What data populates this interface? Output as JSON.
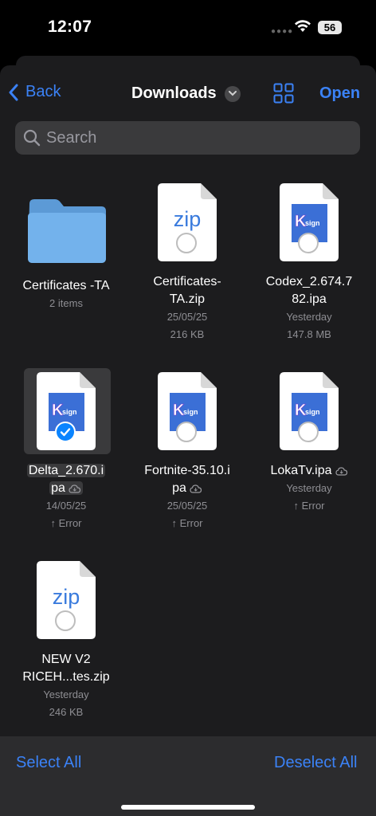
{
  "status": {
    "time": "12:07",
    "battery": "56"
  },
  "nav": {
    "back_label": "Back",
    "title": "Downloads",
    "open_label": "Open"
  },
  "search": {
    "placeholder": "Search"
  },
  "items": [
    {
      "type": "folder",
      "name": "Certificates -TA",
      "meta1": "2 items"
    },
    {
      "type": "zip",
      "name_line1": "Certificates-",
      "name_line2": "TA.zip",
      "meta1": "25/05/25",
      "meta2": "216 KB",
      "icon_text": "zip"
    },
    {
      "type": "ipa",
      "name_line1": "Codex_2.674.7",
      "name_line2": "82.ipa",
      "meta1": "Yesterday",
      "meta2": "147.8 MB"
    },
    {
      "type": "ipa",
      "name_line1": "Delta_2.670.i",
      "name_line2": "pa",
      "meta1": "14/05/25",
      "meta2": "↑ Error",
      "selected": true
    },
    {
      "type": "ipa",
      "name_line1": "Fortnite-35.10.i",
      "name_line2": "pa",
      "meta1": "25/05/25",
      "meta2": "↑ Error"
    },
    {
      "type": "ipa",
      "name_line1": "LokaTv.ipa",
      "meta1": "Yesterday",
      "meta2": "↑ Error"
    },
    {
      "type": "zip",
      "name_line1": "NEW V2",
      "name_line2": "RICEH...tes.zip",
      "meta1": "Yesterday",
      "meta2": "246 KB",
      "icon_text": "zip"
    }
  ],
  "toolbar": {
    "select_all": "Select All",
    "deselect_all": "Deselect All"
  },
  "colors": {
    "accent": "#3b82f6",
    "background": "#1c1c1e",
    "folder": "#6fb0e8"
  }
}
